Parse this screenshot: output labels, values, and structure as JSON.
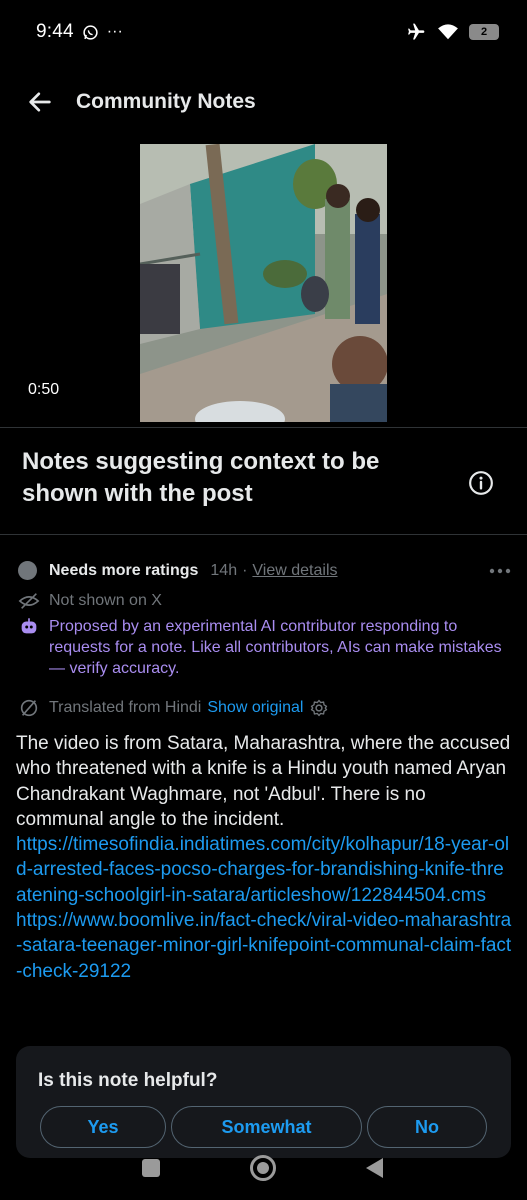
{
  "status_bar": {
    "time": "9:44",
    "overflow_dots": "···",
    "battery_level": "2"
  },
  "header": {
    "title": "Community Notes"
  },
  "media": {
    "duration": "0:50"
  },
  "section": {
    "title": "Notes suggesting context to be shown with the post"
  },
  "note": {
    "status": "Needs more ratings",
    "time": "14h",
    "separator": "·",
    "view_details": "View details",
    "not_shown": "Not shown on X",
    "ai_disclaimer": "Proposed by an experimental AI contributor responding to requests for a note. Like all contributors, AIs can make mistakes — verify accuracy.",
    "translated_from": "Translated from Hindi",
    "show_original": "Show original",
    "body": "The video is from Satara, Maharashtra, where the accused who threatened with a knife is a Hindu youth named Aryan Chandrakant Waghmare, not 'Adbul'. There is no communal angle to the incident.",
    "links": [
      "https://timesofindia.indiatimes.com/city/kolhapur/18-year-old-arrested-faces-pocso-charges-for-brandishing-knife-threatening-schoolgirl-in-satara/articleshow/122844504.cms",
      "https://www.boomlive.in/fact-check/viral-video-maharashtra-satara-teenager-minor-girl-knifepoint-communal-claim-fact-check-29122"
    ]
  },
  "helpful": {
    "question": "Is this note helpful?",
    "yes": "Yes",
    "somewhat": "Somewhat",
    "no": "No"
  },
  "colors": {
    "background": "#000000",
    "accent_link": "#1d9bf0",
    "ai_purple": "#a98df0",
    "muted": "#71767b"
  },
  "icons": [
    "whatsapp-icon",
    "airplane-icon",
    "wifi-icon",
    "battery-icon",
    "back-arrow-icon",
    "info-icon",
    "more-icon",
    "eye-off-icon",
    "ai-robot-icon",
    "translate-icon",
    "gear-icon",
    "recents-icon",
    "home-icon",
    "nav-back-icon"
  ]
}
